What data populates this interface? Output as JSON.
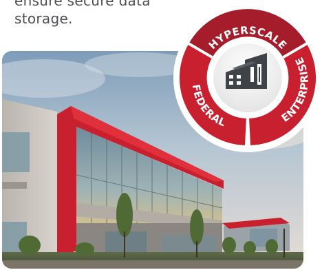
{
  "intro": {
    "text": "ensure secure data storage."
  },
  "badge": {
    "segments": [
      {
        "label": "HYPERSCALE",
        "icon": "data-center-building-icon"
      },
      {
        "label": "ENTERPRISE"
      },
      {
        "label": "FEDERAL"
      }
    ],
    "center_icon": "data-center-building-icon"
  },
  "photo": {
    "subject": "data-center-building-photo"
  },
  "colors": {
    "brand_red": "#c8202f",
    "brand_red_dark": "#a51d2b",
    "ring_white": "#ffffff",
    "text_gray": "#4b4f54",
    "icon_dark": "#3f4246"
  }
}
